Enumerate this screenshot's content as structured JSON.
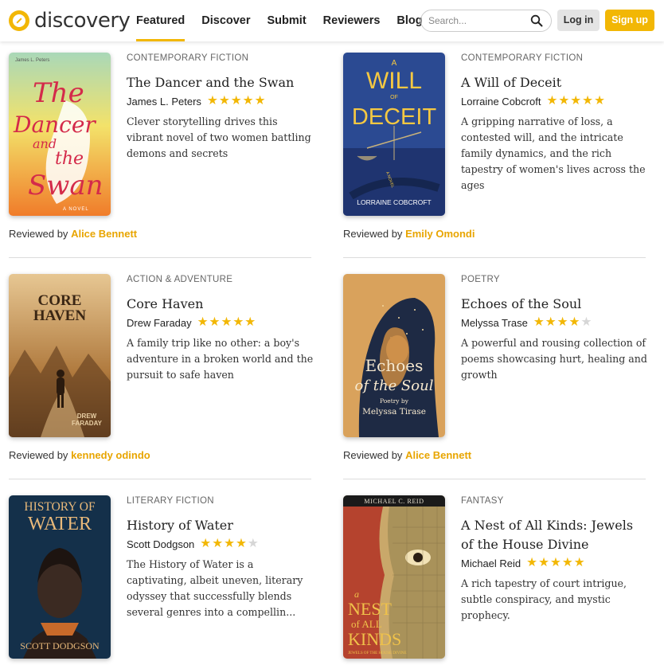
{
  "brand": {
    "name": "discovery"
  },
  "nav": [
    {
      "label": "Featured"
    },
    {
      "label": "Discover"
    },
    {
      "label": "Submit"
    },
    {
      "label": "Reviewers"
    },
    {
      "label": "Blog"
    }
  ],
  "search": {
    "placeholder": "Search..."
  },
  "auth": {
    "login": "Log in",
    "signup": "Sign up"
  },
  "reviewed_prefix": "Reviewed by",
  "colors": {
    "accent": "#f2b705",
    "reviewer": "#e8a500"
  },
  "books": [
    {
      "genre": "CONTEMPORARY FICTION",
      "title": "The Dancer and the Swan",
      "author": "James L. Peters",
      "rating": 5,
      "description": "Clever storytelling drives this vibrant novel of two women battling demons and secrets",
      "reviewer": "Alice Bennett",
      "cover": {
        "top": "James L. Peters",
        "l1": "The",
        "l2": "Dancer",
        "l3": "and",
        "l4": "the",
        "l5": "Swan",
        "tag": "A NOVEL"
      }
    },
    {
      "genre": "CONTEMPORARY FICTION",
      "title": "A Will of Deceit",
      "author": "Lorraine Cobcroft",
      "rating": 5,
      "description": "A gripping narrative of loss, a contested will, and the intricate family dynamics, and the rich tapestry of women's lives across the ages",
      "reviewer": "Emily Omondi",
      "cover": {
        "a": "A",
        "l1": "WILL",
        "of": "OF",
        "l2": "DECEIT",
        "tag": "A NOVEL",
        "author": "LORRAINE COBCROFT"
      }
    },
    {
      "genre": "ACTION & ADVENTURE",
      "title": "Core Haven",
      "author": "Drew Faraday",
      "rating": 5,
      "description": "A family trip like no other: a boy's adventure in a broken world and the pursuit to safe haven",
      "reviewer": "kennedy odindo",
      "cover": {
        "l1": "CORE",
        "l2": "HAVEN",
        "a1": "DREW",
        "a2": "FARADAY"
      }
    },
    {
      "genre": "POETRY",
      "title": "Echoes of the Soul",
      "author": "Melyssa Trase",
      "rating": 4,
      "description": "A powerful and rousing collection of poems showcasing hurt, healing and growth",
      "reviewer": "Alice Bennett",
      "cover": {
        "l1": "Echoes",
        "l2": "of the Soul",
        "l3": "Poetry by",
        "l4": "Melyssa Tirase"
      }
    },
    {
      "genre": "LITERARY FICTION",
      "title": "History of Water",
      "author": "Scott Dodgson",
      "rating": 4,
      "description": "The History of Water is a captivating, albeit uneven, literary odyssey that successfully blends several genres into a compellin...",
      "reviewer": "",
      "cover": {
        "l1": "HISTORY OF",
        "l2": "WATER",
        "author": "SCOTT DODGSON"
      }
    },
    {
      "genre": "FANTASY",
      "title": "A Nest of All Kinds: Jewels of the House Divine",
      "author": "Michael Reid",
      "rating": 5,
      "description": "A rich tapestry of court intrigue, subtle conspiracy, and mystic prophecy.",
      "reviewer": "",
      "cover": {
        "author": "MICHAEL C. REID",
        "l1": "a",
        "l2": "NEST",
        "l3": "of ALL",
        "l4": "KINDS",
        "l5": "JEWELS OF THE HOUSE DIVINE"
      }
    }
  ]
}
